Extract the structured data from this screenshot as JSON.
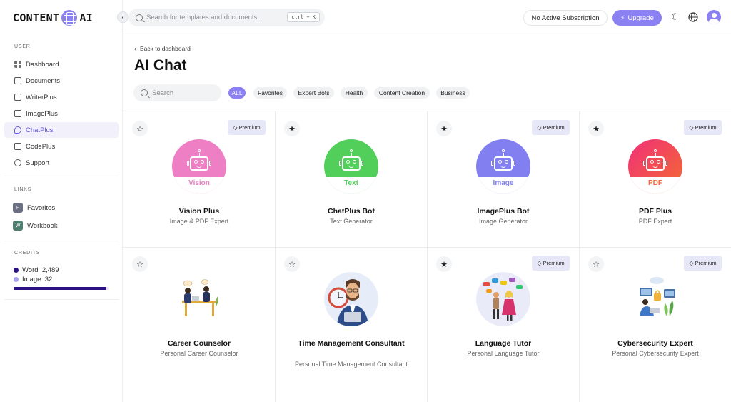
{
  "brand": {
    "left": "CONTENT",
    "right": "AI"
  },
  "sidebar": {
    "user_label": "USER",
    "items": [
      {
        "label": "Dashboard",
        "icon": "grid-icon",
        "active": false
      },
      {
        "label": "Documents",
        "icon": "archive-icon",
        "active": false
      },
      {
        "label": "WriterPlus",
        "icon": "document-icon",
        "active": false
      },
      {
        "label": "ImagePlus",
        "icon": "image-icon",
        "active": false
      },
      {
        "label": "ChatPlus",
        "icon": "chat-icon",
        "active": true
      },
      {
        "label": "CodePlus",
        "icon": "terminal-icon",
        "active": false
      },
      {
        "label": "Support",
        "icon": "lifebuoy-icon",
        "active": false
      }
    ],
    "links_label": "LINKS",
    "links": [
      {
        "initial": "F",
        "label": "Favorites",
        "color": "#6b6f82"
      },
      {
        "initial": "W",
        "label": "Workbook",
        "color": "#4f7d6f"
      }
    ],
    "credits_label": "CREDITS",
    "credits": [
      {
        "label": "Word",
        "value": "2,489",
        "color": "#2b1184"
      },
      {
        "label": "Image",
        "value": "32",
        "color": "#a9a3ef"
      }
    ],
    "credit_fill_fraction": 0.98
  },
  "header": {
    "search_placeholder": "Search for templates and documents...",
    "shortcut": "ctrl + K",
    "subscription": "No Active Subscription",
    "upgrade": "Upgrade"
  },
  "page": {
    "back": "Back to dashboard",
    "title": "AI Chat",
    "search_placeholder": "Search",
    "filters": [
      "ALL",
      "Favorites",
      "Expert Bots",
      "Health",
      "Content Creation",
      "Business"
    ]
  },
  "premium_label": "Premium",
  "cards": [
    {
      "title": "Vision Plus",
      "subtitle": "Image & PDF Expert",
      "badge": "Vision",
      "favorite": false,
      "premium": true,
      "color": "#ee7fc4"
    },
    {
      "title": "ChatPlus Bot",
      "subtitle": "Text Generator",
      "badge": "Text",
      "favorite": true,
      "premium": false,
      "color": "#52cf5a"
    },
    {
      "title": "ImagePlus Bot",
      "subtitle": "Image Generator",
      "badge": "Image",
      "favorite": true,
      "premium": true,
      "color": "#8280f1"
    },
    {
      "title": "PDF Plus",
      "subtitle": "PDF Expert",
      "badge": "PDF",
      "favorite": true,
      "premium": true,
      "color": "#f0484c"
    },
    {
      "title": "Career Counselor",
      "subtitle": "Personal Career Counselor",
      "favorite": false,
      "premium": false,
      "illustration": "career"
    },
    {
      "title": "Time Management Consultant",
      "subtitle": "Personal Time Management Consultant",
      "favorite": false,
      "premium": false,
      "illustration": "time"
    },
    {
      "title": "Language Tutor",
      "subtitle": "Personal Language Tutor",
      "favorite": true,
      "premium": true,
      "illustration": "language"
    },
    {
      "title": "Cybersecurity Expert",
      "subtitle": "Personal Cybersecurity Expert",
      "favorite": false,
      "premium": true,
      "illustration": "cyber"
    }
  ]
}
